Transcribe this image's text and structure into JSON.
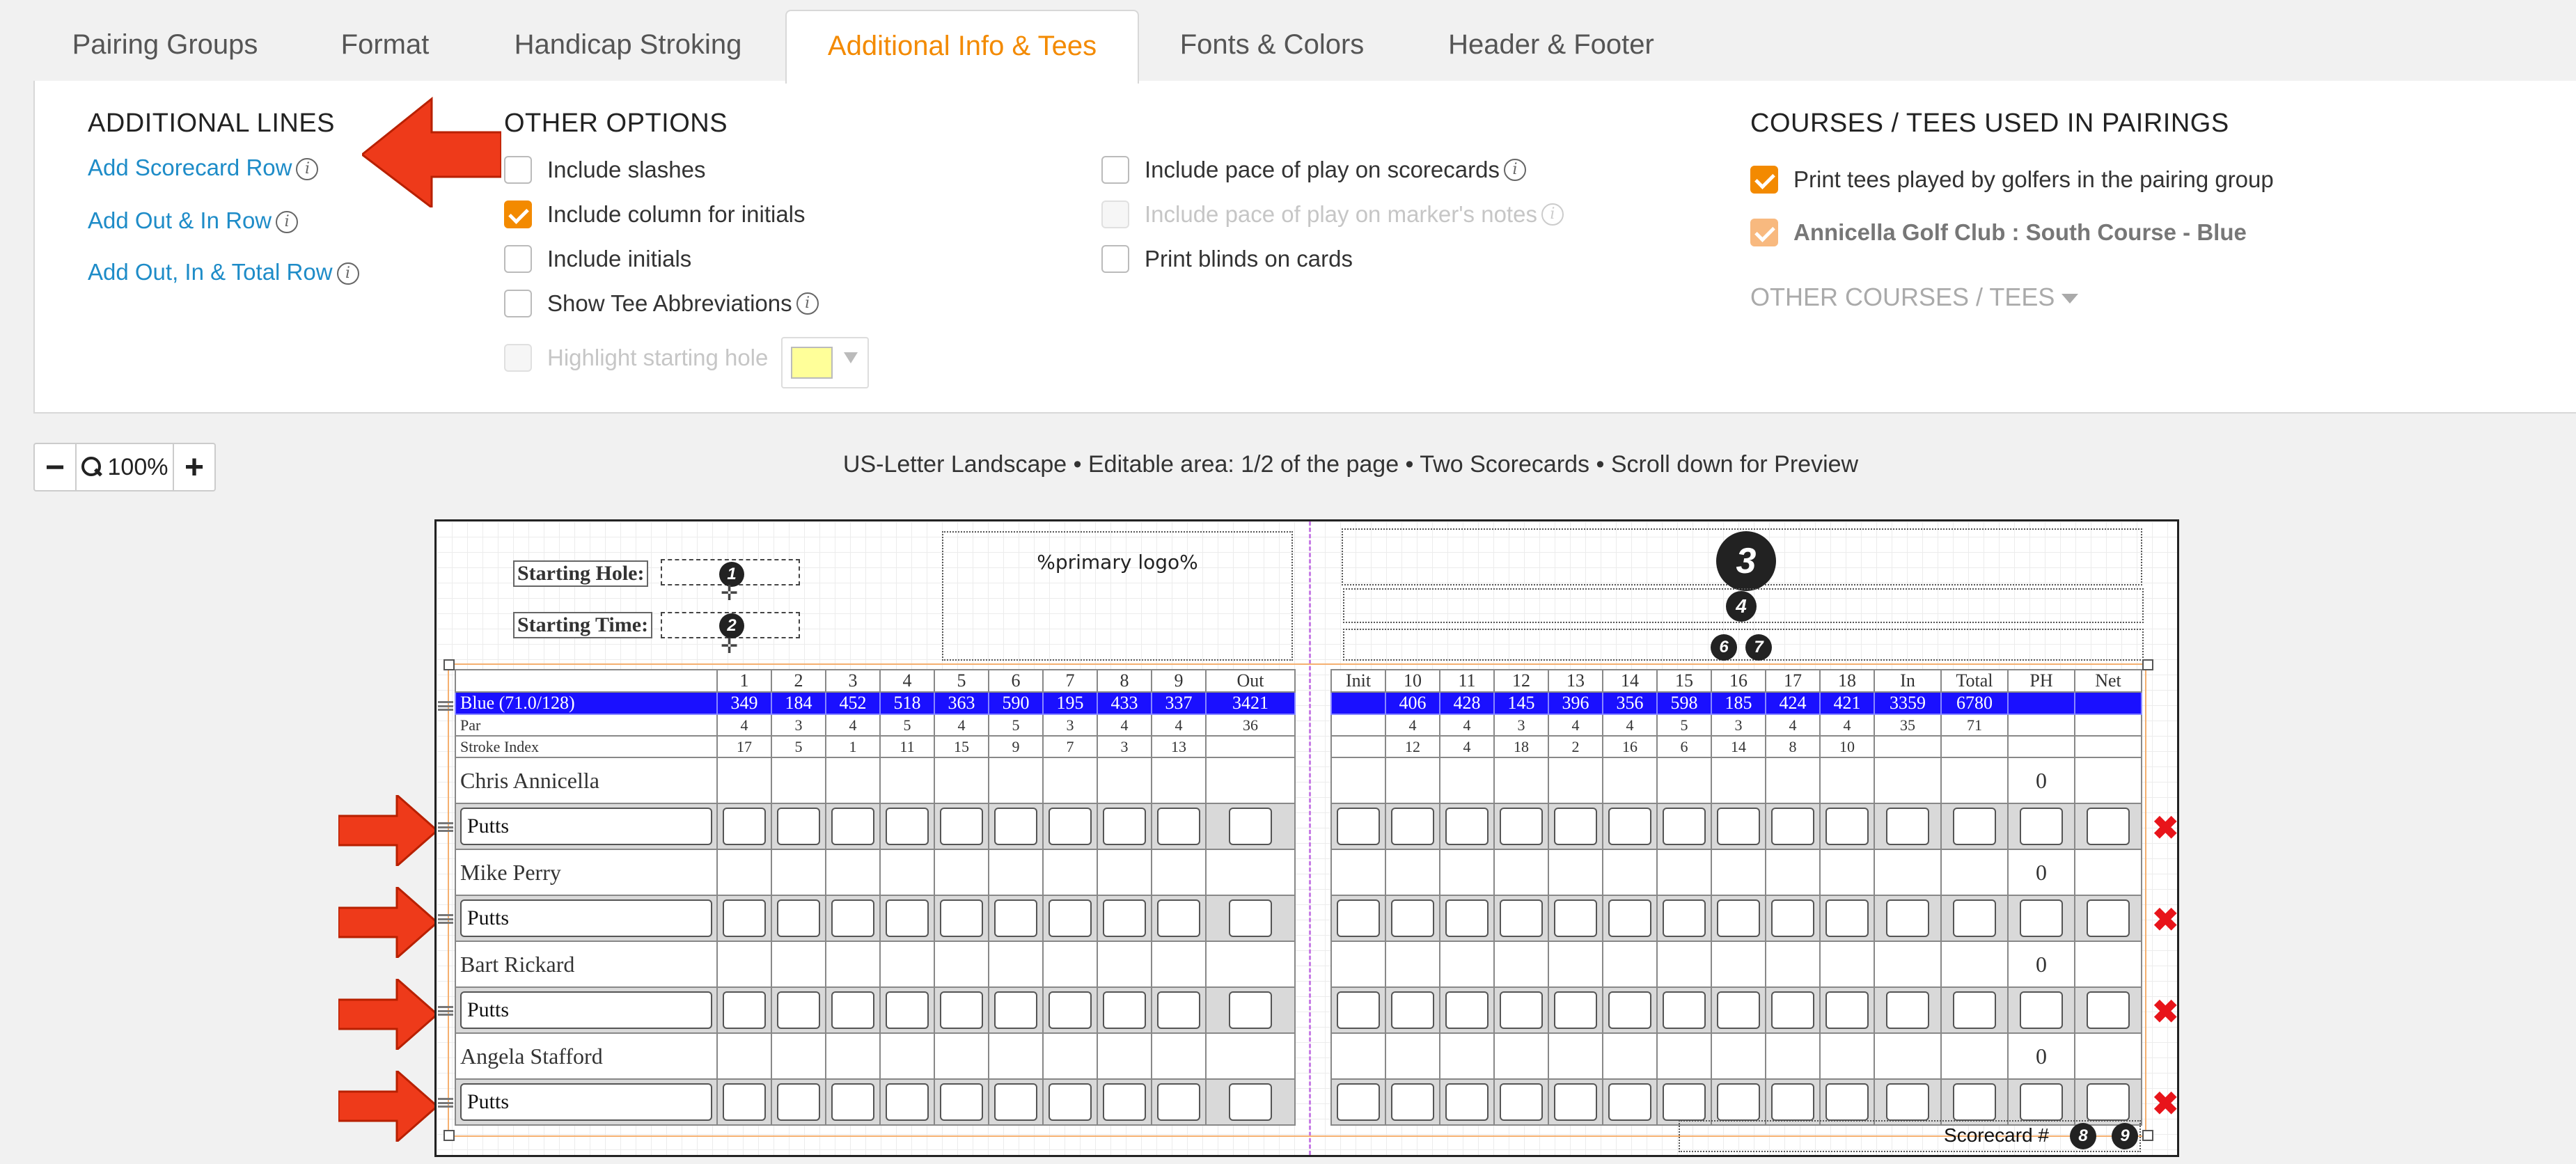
{
  "tabs": [
    {
      "label": "Pairing Groups"
    },
    {
      "label": "Format"
    },
    {
      "label": "Handicap Stroking"
    },
    {
      "label": "Additional Info & Tees",
      "active": true
    },
    {
      "label": "Fonts & Colors"
    },
    {
      "label": "Header & Footer"
    }
  ],
  "additional_lines": {
    "title": "ADDITIONAL LINES",
    "links": [
      "Add Scorecard Row",
      "Add Out & In Row",
      "Add Out, In & Total Row"
    ]
  },
  "other_options": {
    "title": "OTHER OPTIONS",
    "col1": [
      {
        "label": "Include slashes",
        "checked": false
      },
      {
        "label": "Include column for initials",
        "checked": true
      },
      {
        "label": "Include initials",
        "checked": false
      },
      {
        "label": "Show Tee Abbreviations",
        "checked": false
      },
      {
        "label": "Highlight starting hole",
        "checked": false,
        "disabled": true
      }
    ],
    "col2": [
      {
        "label": "Include pace of play on scorecards",
        "checked": false
      },
      {
        "label": "Include pace of play on marker's notes",
        "checked": false,
        "disabled": true
      },
      {
        "label": "Print blinds on cards",
        "checked": false
      }
    ],
    "highlight_color": "#ffff99"
  },
  "courses": {
    "title": "COURSES / TEES USED IN PAIRINGS",
    "print_tees_label": "Print tees played by golfers in the pairing group",
    "course_label": "Annicella Golf Club : South Course - Blue",
    "other_label": "OTHER COURSES / TEES"
  },
  "zoom": {
    "minus": "−",
    "value": "100%",
    "plus": "+"
  },
  "status_text": "US-Letter Landscape • Editable area: 1/2 of the page • Two Scorecards • Scroll down for Preview",
  "scorecard": {
    "starting_hole_label": "Starting Hole:",
    "starting_time_label": "Starting Time:",
    "logo_placeholder": "%primary logo%",
    "badges": [
      "1",
      "2",
      "3",
      "4",
      "6",
      "7",
      "8",
      "9"
    ],
    "front_holes": [
      "1",
      "2",
      "3",
      "4",
      "5",
      "6",
      "7",
      "8",
      "9",
      "Out"
    ],
    "back_holes": [
      "Init",
      "10",
      "11",
      "12",
      "13",
      "14",
      "15",
      "16",
      "17",
      "18",
      "In",
      "Total",
      "PH",
      "Net"
    ],
    "tee_name": "Blue (71.0/128)",
    "tee_front": [
      "349",
      "184",
      "452",
      "518",
      "363",
      "590",
      "195",
      "433",
      "337",
      "3421"
    ],
    "tee_back": [
      "",
      "406",
      "428",
      "145",
      "396",
      "356",
      "598",
      "185",
      "424",
      "421",
      "3359",
      "6780",
      "",
      ""
    ],
    "par_label": "Par",
    "par_front": [
      "4",
      "3",
      "4",
      "5",
      "4",
      "5",
      "3",
      "4",
      "4",
      "36"
    ],
    "par_back": [
      "",
      "4",
      "4",
      "3",
      "4",
      "4",
      "5",
      "3",
      "4",
      "4",
      "35",
      "71",
      "",
      ""
    ],
    "si_label": "Stroke Index",
    "si_front": [
      "17",
      "5",
      "1",
      "11",
      "15",
      "9",
      "7",
      "3",
      "13",
      ""
    ],
    "si_back": [
      "",
      "12",
      "4",
      "18",
      "2",
      "16",
      "6",
      "14",
      "8",
      "10",
      "",
      "",
      "",
      ""
    ],
    "players": [
      "Chris Annicella",
      "Mike Perry",
      "Bart Rickard",
      "Angela Stafford"
    ],
    "player_ph": "0",
    "putts_label": "Putts",
    "scorecard_no_label": "Scorecard #",
    "tee_color": "#1a10ff"
  },
  "colors": {
    "accent": "#f38a00",
    "link": "#1e8cc8",
    "arrow": "#e8341a",
    "delete": "#e8141a"
  }
}
